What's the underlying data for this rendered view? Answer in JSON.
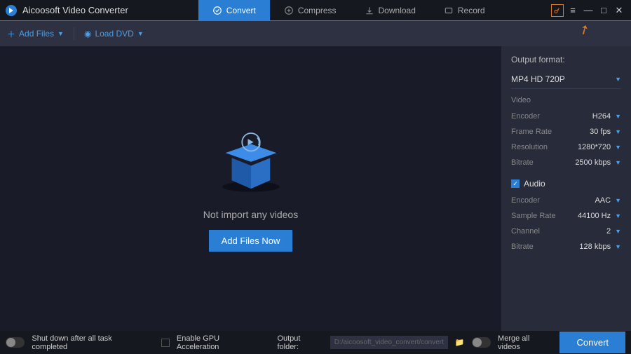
{
  "app": {
    "title": "Aicoosoft Video Converter"
  },
  "tabs": {
    "convert": "Convert",
    "compress": "Compress",
    "download": "Download",
    "record": "Record"
  },
  "toolbar": {
    "add_files": "Add Files",
    "load_dvd": "Load DVD"
  },
  "empty": {
    "message": "Not import any videos",
    "button": "Add Files Now"
  },
  "output": {
    "label": "Output format:",
    "format": "MP4 HD 720P",
    "video_section": "Video",
    "video": {
      "encoder_label": "Encoder",
      "encoder": "H264",
      "framerate_label": "Frame Rate",
      "framerate": "30 fps",
      "resolution_label": "Resolution",
      "resolution": "1280*720",
      "bitrate_label": "Bitrate",
      "bitrate": "2500 kbps"
    },
    "audio_section": "Audio",
    "audio": {
      "encoder_label": "Encoder",
      "encoder": "AAC",
      "samplerate_label": "Sample Rate",
      "samplerate": "44100 Hz",
      "channel_label": "Channel",
      "channel": "2",
      "bitrate_label": "Bitrate",
      "bitrate": "128 kbps"
    }
  },
  "footer": {
    "shutdown": "Shut down after all task completed",
    "gpu": "Enable GPU Acceleration",
    "folder_label": "Output folder:",
    "folder_path": "D:/aicoosoft_video_convert/convert",
    "merge": "Merge all videos",
    "convert": "Convert"
  }
}
